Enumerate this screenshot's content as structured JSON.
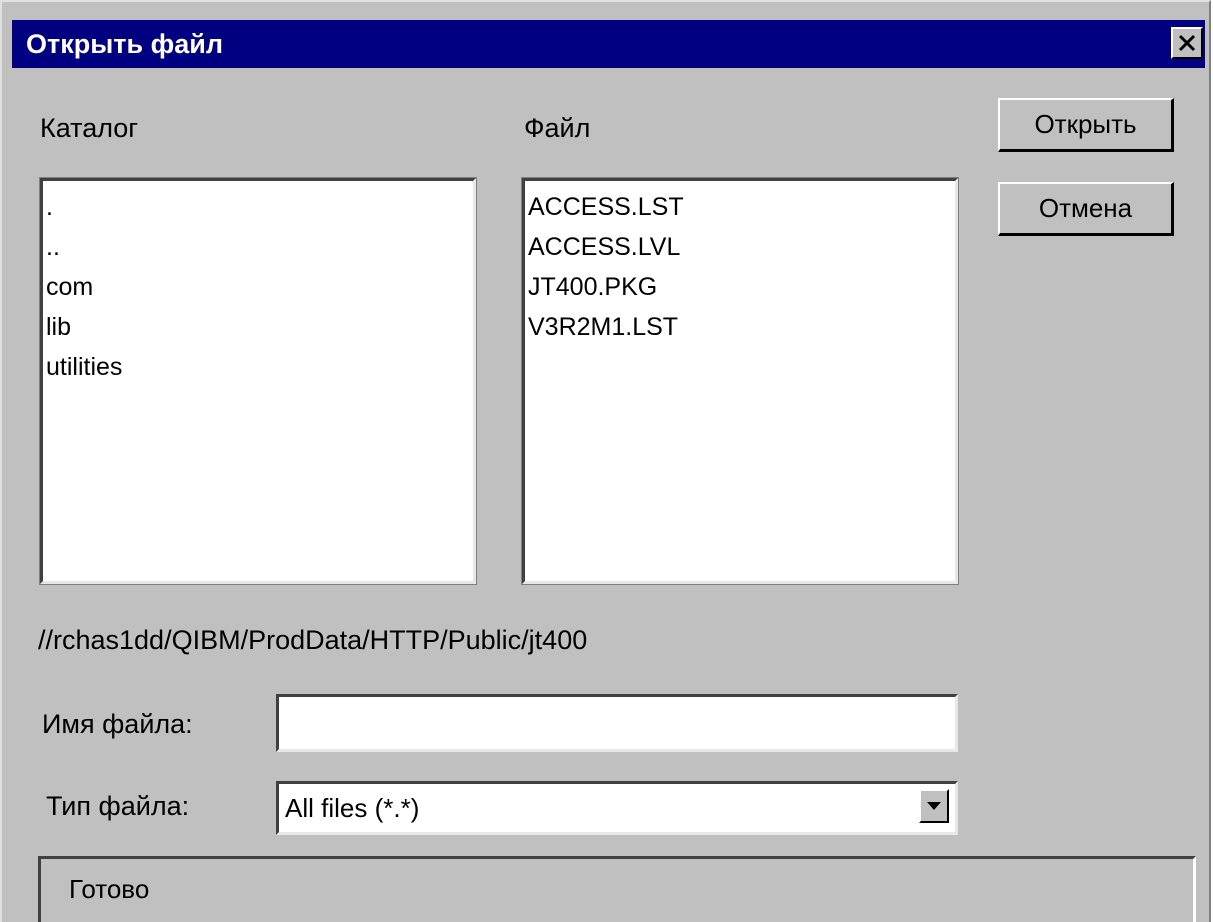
{
  "window": {
    "title": "Открыть файл",
    "close_glyph": "✕"
  },
  "directory": {
    "label": "Каталог",
    "items": [
      ".",
      "..",
      "com",
      "lib",
      "utilities"
    ]
  },
  "file": {
    "label": "Файл",
    "items": [
      "ACCESS.LST",
      "ACCESS.LVL",
      "JT400.PKG",
      "V3R2M1.LST"
    ]
  },
  "buttons": {
    "open": "Открыть",
    "cancel": "Отмена"
  },
  "path": "//rchas1dd/QIBM/ProdData/HTTP/Public/jt400",
  "filename": {
    "label": "Имя файла:",
    "value": ""
  },
  "filetype": {
    "label": "Тип файла:",
    "selected": "All files (*.*)"
  },
  "status": "Готово",
  "colors": {
    "titlebar": "#000080",
    "face": "#c0c0c0",
    "field": "#ffffff"
  },
  "icons": {
    "close": "close-icon",
    "dropdown": "chevron-down-icon"
  }
}
